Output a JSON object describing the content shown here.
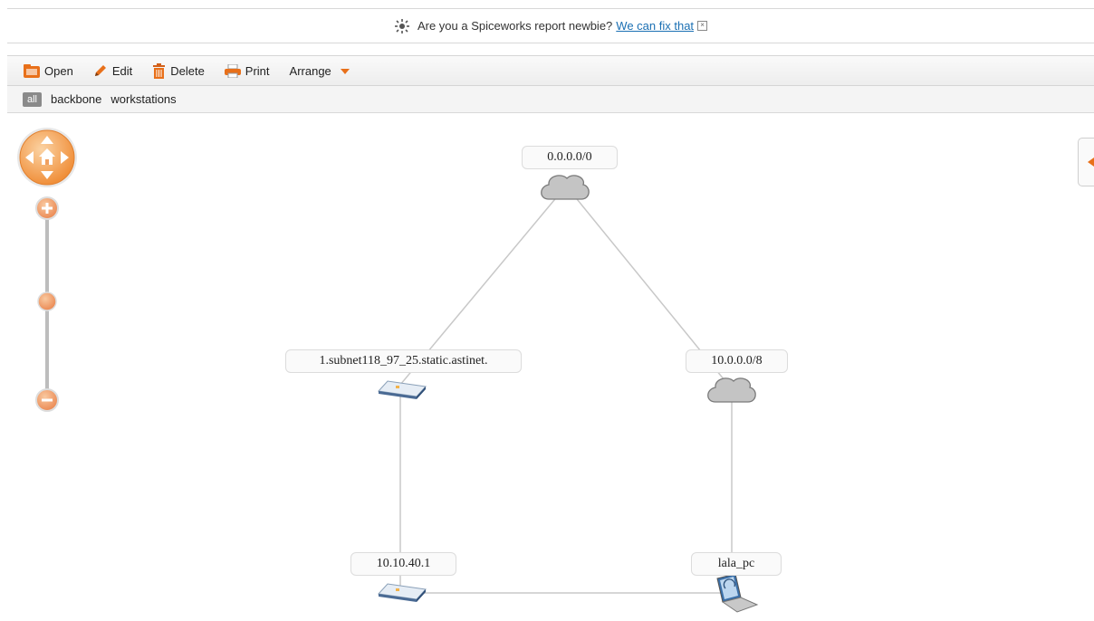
{
  "banner": {
    "text": "Are you a Spiceworks report newbie?",
    "link": "We can fix that",
    "close_glyph": "×"
  },
  "toolbar": {
    "open_label": "Open",
    "edit_label": "Edit",
    "delete_label": "Delete",
    "print_label": "Print",
    "arrange_label": "Arrange"
  },
  "filters": {
    "all_label": "all",
    "items": [
      "backbone",
      "workstations"
    ]
  },
  "nodes": [
    {
      "label": "0.0.0.0/0",
      "icon": "cloud-icon"
    },
    {
      "label": "1.subnet118_97_25.static.astinet.",
      "icon": "switch-icon"
    },
    {
      "label": "10.0.0.0/8",
      "icon": "cloud-icon"
    },
    {
      "label": "10.10.40.1",
      "icon": "switch-icon"
    },
    {
      "label": "lala_pc",
      "icon": "laptop-icon"
    }
  ],
  "colors": {
    "accent": "#e8701a",
    "link": "#1a6fb3",
    "edge": "#c8c8c8"
  }
}
